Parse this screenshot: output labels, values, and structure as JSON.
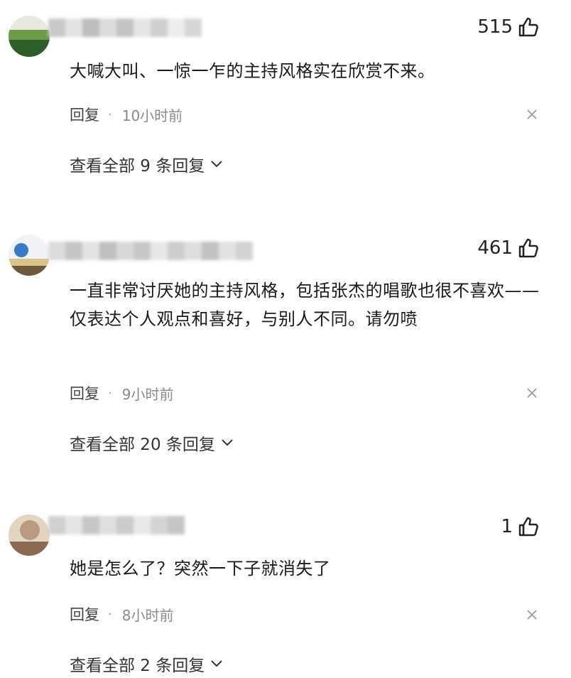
{
  "comments": [
    {
      "likes": "515",
      "text": "大喊大叫、一惊一乍的主持风格实在欣赏不来。",
      "reply_label": "回复",
      "separator": "·",
      "time": "10小时前",
      "view_replies": "查看全部 9 条回复",
      "avatar_colors": [
        "#2f5d2a",
        "#6f9a4a",
        "#e8eadf"
      ]
    },
    {
      "likes": "461",
      "text": "一直非常讨厌她的主持风格，包括张杰的唱歌也很不喜欢——仅表达个人观点和喜好，与别人不同。请勿喷",
      "reply_label": "回复",
      "separator": "·",
      "time": "9小时前",
      "view_replies": "查看全部 20 条回复",
      "avatar_colors": [
        "#3a78c8",
        "#d8c38a",
        "#6d5a3c"
      ]
    },
    {
      "likes": "1",
      "text": "她是怎么了？突然一下子就消失了",
      "reply_label": "回复",
      "separator": "·",
      "time": "8小时前",
      "view_replies": "查看全部 2 条回复",
      "avatar_colors": [
        "#b89b80",
        "#8c6a52",
        "#e4d4c2"
      ]
    }
  ],
  "icons": {
    "like": "thumbs-up-icon",
    "close": "close-icon",
    "expand": "chevron-down-icon"
  }
}
